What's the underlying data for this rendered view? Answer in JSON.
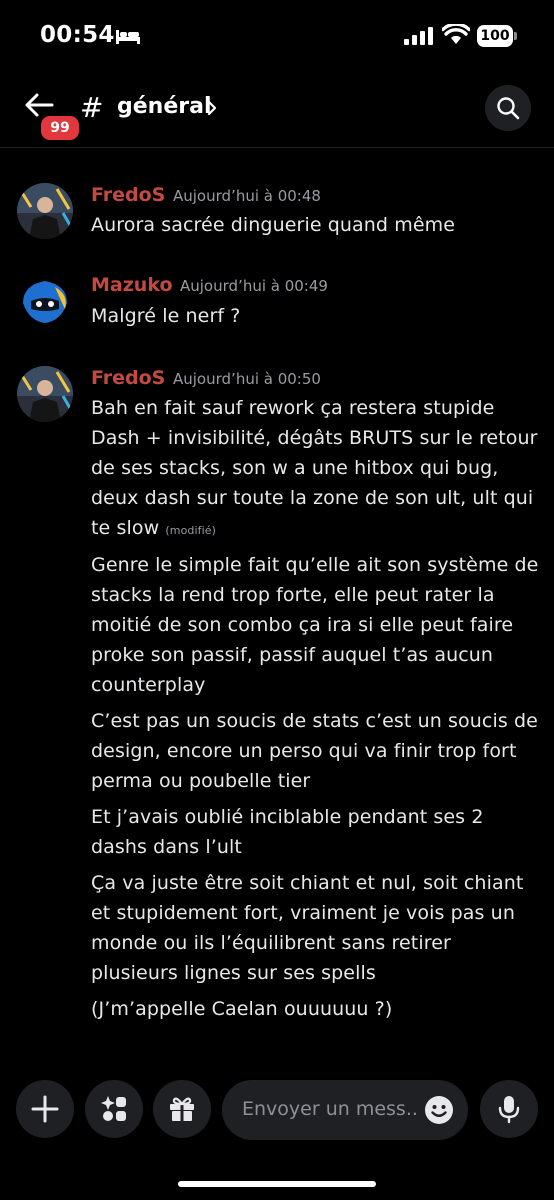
{
  "status_bar": {
    "time": "00:54",
    "battery": "100"
  },
  "header": {
    "unread_badge": "99",
    "hash": "#",
    "channel": "général",
    "icons": [
      "back-arrow-icon",
      "chevron-right-icon",
      "search-icon"
    ]
  },
  "messages": [
    {
      "author": "FredoS",
      "timestamp": "Aujourd’hui à 00:48",
      "lines": [
        "Aurora sacrée dinguerie quand même"
      ]
    },
    {
      "author": "Mazuko",
      "timestamp": "Aujourd’hui à 00:49",
      "lines": [
        "Malgré le nerf ?"
      ]
    },
    {
      "author": "FredoS",
      "timestamp": "Aujourd’hui à 00:50",
      "lines": [
        "Bah en fait sauf rework ça restera stupide",
        "Dash + invisibilité, dégâts BRUTS sur le retour",
        "de ses stacks, son w a une hitbox qui bug,",
        "deux dash sur toute la zone de son ult, ult qui",
        "te slow"
      ],
      "edited_label": "(modifié)",
      "followups": [
        [
          "Genre le simple fait qu’elle ait son système de",
          "stacks la rend trop forte, elle peut rater la",
          "moitié de son combo ça ira si elle peut faire",
          "proke son passif, passif auquel t’as aucun",
          "counterplay"
        ],
        [
          "C’est pas un soucis de stats c’est un soucis de",
          "design, encore un perso qui va finir trop fort",
          "perma ou poubelle tier"
        ],
        [
          "Et j’avais oublié inciblable pendant ses 2",
          "dashs dans l’ult"
        ],
        [
          "Ça va juste être soit chiant et nul, soit chiant",
          "et stupidement fort, vraiment je vois pas un",
          "monde ou ils l’équilibrent sans retirer",
          "plusieurs lignes sur ses spells"
        ],
        [
          "(J’m’appelle Caelan ouuuuuu ?)"
        ]
      ]
    }
  ],
  "composer": {
    "placeholder": "Envoyer un mess..",
    "icons": [
      "plus-icon",
      "apps-icon",
      "gift-icon",
      "emoji-icon",
      "microphone-icon"
    ]
  },
  "colors": {
    "author": "#c24a40",
    "background": "#000000",
    "surface": "#1f2024",
    "badge": "#e0383d"
  }
}
